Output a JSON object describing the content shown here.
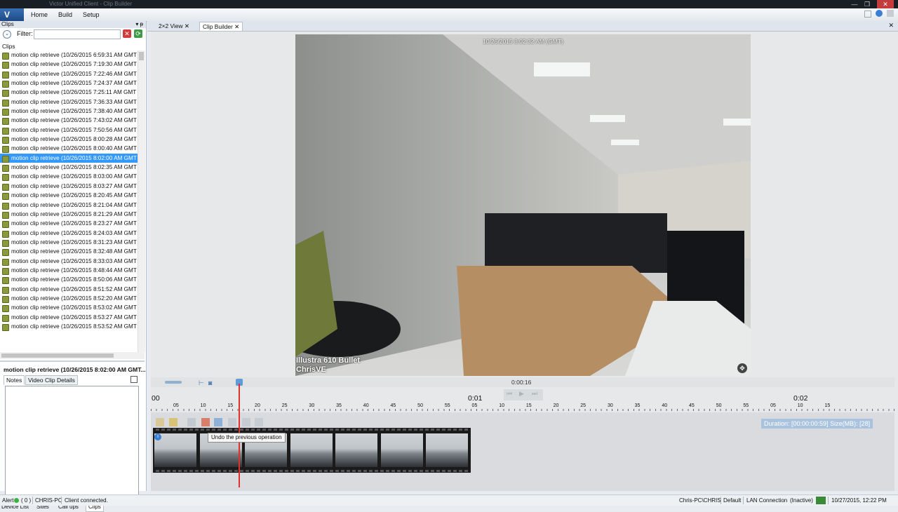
{
  "window": {
    "title": "Victor Unified Client - Clip Builder",
    "min": "—",
    "max": "❐",
    "close": "✕"
  },
  "menu": {
    "logo": "V",
    "items": [
      "Home",
      "Build",
      "Setup"
    ]
  },
  "left_panel": {
    "header": "Clips",
    "pin": "▾ ᵽ",
    "filter_label": "Filter:",
    "filter_value": "",
    "list_header": "Clips",
    "clips": [
      "motion clip retrieve (10/26/2015 6:59:31 AM GMT",
      "motion clip retrieve (10/26/2015 7:19:30 AM GMT",
      "motion clip retrieve (10/26/2015 7:22:46 AM GMT",
      "motion clip retrieve (10/26/2015 7:24:37 AM GMT",
      "motion clip retrieve (10/26/2015 7:25:11 AM GMT",
      "motion clip retrieve (10/26/2015 7:36:33 AM GMT",
      "motion clip retrieve (10/26/2015 7:38:40 AM GMT",
      "motion clip retrieve (10/26/2015 7:43:02 AM GMT",
      "motion clip retrieve (10/26/2015 7:50:56 AM GMT",
      "motion clip retrieve (10/26/2015 8:00:28 AM GMT",
      "motion clip retrieve (10/26/2015 8:00:40 AM GMT",
      "motion clip retrieve (10/26/2015 8:02:00 AM GMT",
      "motion clip retrieve (10/26/2015 8:02:35 AM GMT",
      "motion clip retrieve (10/26/2015 8:03:00 AM GMT",
      "motion clip retrieve (10/26/2015 8:03:27 AM GMT",
      "motion clip retrieve (10/26/2015 8:20:45 AM GMT",
      "motion clip retrieve (10/26/2015 8:21:04 AM GMT",
      "motion clip retrieve (10/26/2015 8:21:29 AM GMT",
      "motion clip retrieve (10/26/2015 8:23:27 AM GMT",
      "motion clip retrieve (10/26/2015 8:24:03 AM GMT",
      "motion clip retrieve (10/26/2015 8:31:23 AM GMT",
      "motion clip retrieve (10/26/2015 8:32:48 AM GMT",
      "motion clip retrieve (10/26/2015 8:33:03 AM GMT",
      "motion clip retrieve (10/26/2015 8:48:44 AM GMT",
      "motion clip retrieve (10/26/2015 8:50:06 AM GMT",
      "motion clip retrieve (10/26/2015 8:51:52 AM GMT",
      "motion clip retrieve (10/26/2015 8:52:20 AM GMT",
      "motion clip retrieve (10/26/2015 8:53:02 AM GMT",
      "motion clip retrieve (10/26/2015 8:53:27 AM GMT",
      "motion clip retrieve (10/26/2015 8:53:52 AM GMT"
    ],
    "selected_index": 11,
    "detail_title": "motion clip retrieve (10/26/2015 8:02:00 AM GMT...",
    "detail_tabs": [
      "Notes",
      "Video Clip Details"
    ],
    "notes": "",
    "bottom_tabs": [
      "Device List",
      "Sites",
      "Call ups",
      "Clips"
    ]
  },
  "doc_tabs": [
    "2×2 View",
    "Clip Builder"
  ],
  "video": {
    "timestamp": "10/26/2015 8:02:32 AM (GMT)",
    "camera_name": "Illustra 610 Bullet",
    "server_name": "ChrisVE"
  },
  "timeline": {
    "current_time": "0:00:16",
    "major_labels": [
      "00",
      "0:01",
      "0:02"
    ],
    "minor_labels": [
      "05",
      "10",
      "15",
      "20",
      "25",
      "30",
      "35",
      "40",
      "45",
      "50",
      "55",
      "05",
      "10",
      "15",
      "20",
      "25",
      "30",
      "35",
      "40",
      "45",
      "50",
      "55",
      "05",
      "10",
      "15"
    ],
    "tooltip": "Undo the previous operation",
    "duration": "Duration: [00:00:00:59] Size(MB): [28]"
  },
  "status": {
    "alert": "Alert",
    "alert_count": "( 0 )",
    "machine": "CHRIS-PC",
    "client_status": "Client connected.",
    "user": "Chris-PC\\CHRIS",
    "profile": "Default",
    "connection": "LAN Connection",
    "connection_state": "(Inactive)",
    "datetime": "10/27/2015, 12:22 PM"
  }
}
